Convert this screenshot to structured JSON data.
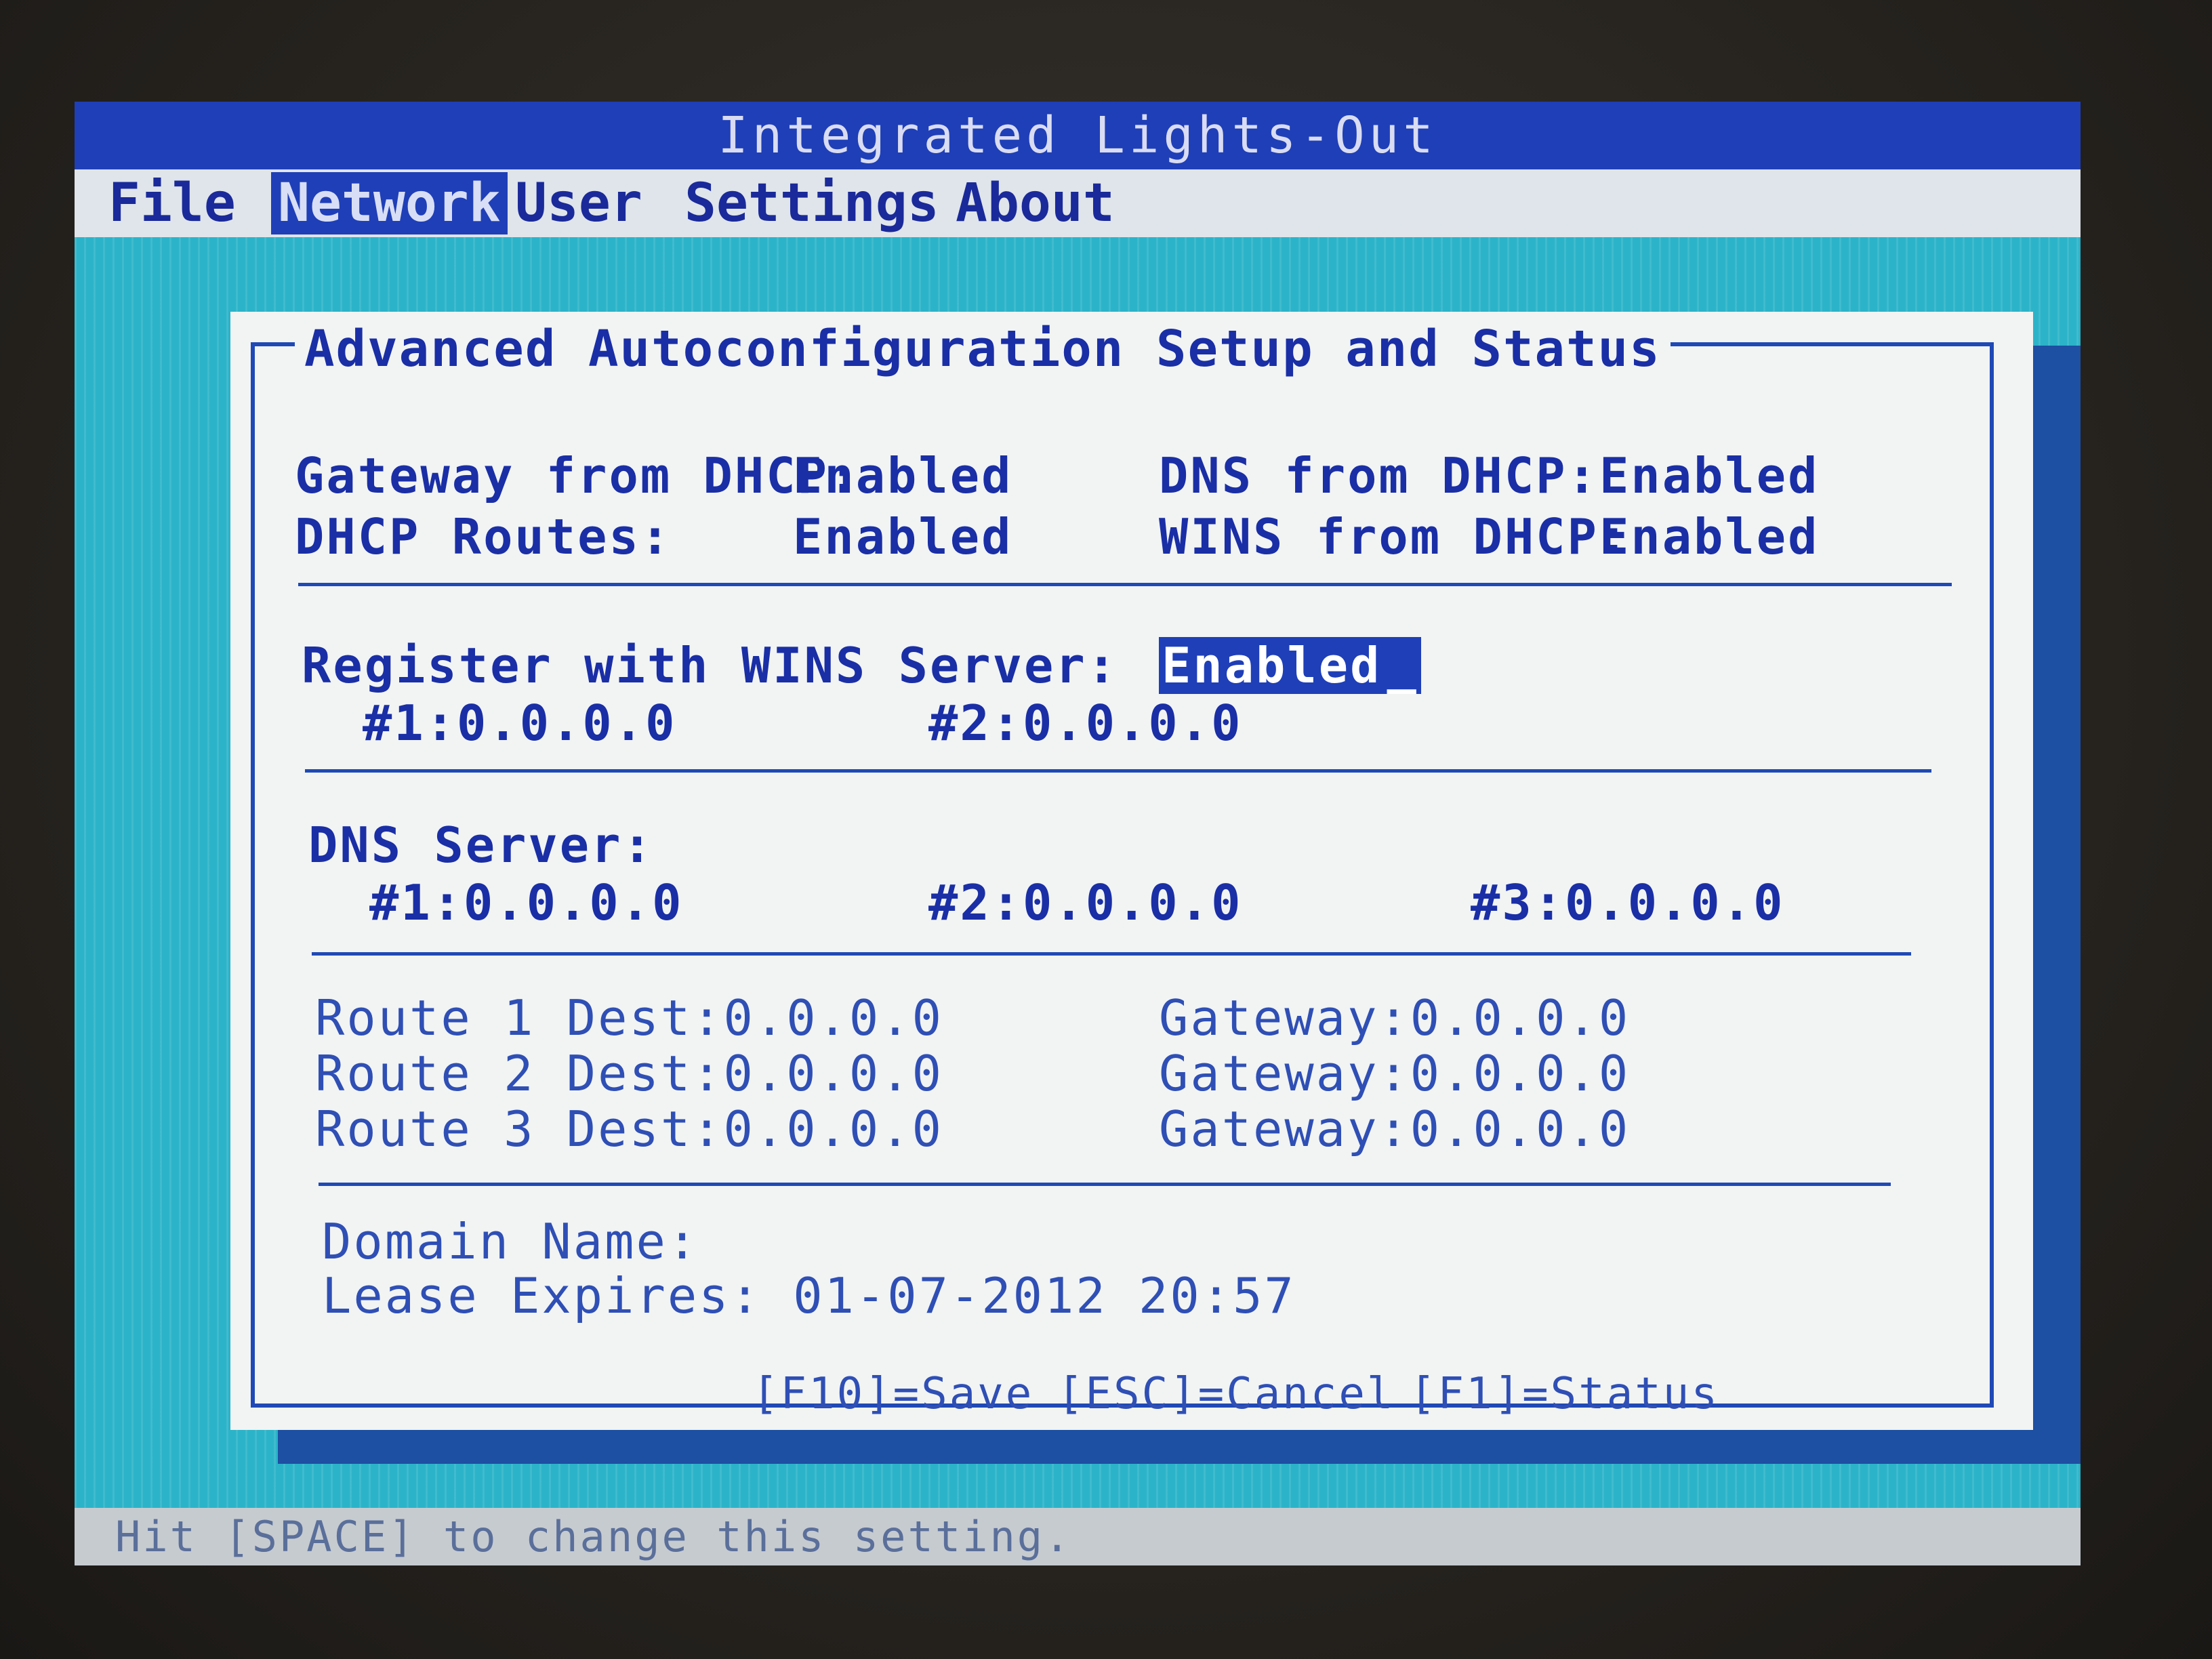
{
  "window": {
    "title": "Integrated Lights-Out"
  },
  "menu": {
    "items": [
      {
        "label": "File"
      },
      {
        "label": "Network"
      },
      {
        "label": "User"
      },
      {
        "label": "Settings"
      },
      {
        "label": "About"
      }
    ],
    "active": "Network"
  },
  "dialog": {
    "title": "Advanced Autoconfiguration Setup and Status",
    "dhcp": {
      "gateway_label": "Gateway from DHCP:",
      "gateway_value": "Enabled",
      "routes_label": "DHCP Routes:",
      "routes_value": "Enabled",
      "dns_label": "DNS from DHCP:",
      "dns_value": "Enabled",
      "wins_label": "WINS from DHCP:",
      "wins_value": "Enabled"
    },
    "wins": {
      "register_label": "Register with WINS Server:",
      "register_value": "Enabled",
      "cursor": "_",
      "server1": "#1:0.0.0.0",
      "server2": "#2:0.0.0.0"
    },
    "dns": {
      "label": "DNS Server:",
      "server1": "#1:0.0.0.0",
      "server2": "#2:0.0.0.0",
      "server3": "#3:0.0.0.0"
    },
    "routes": [
      {
        "dest": "Route 1 Dest:0.0.0.0",
        "gateway": "Gateway:0.0.0.0"
      },
      {
        "dest": "Route 2 Dest:0.0.0.0",
        "gateway": "Gateway:0.0.0.0"
      },
      {
        "dest": "Route 3 Dest:0.0.0.0",
        "gateway": "Gateway:0.0.0.0"
      }
    ],
    "domain_name_label": "Domain Name:",
    "lease_expires": "Lease Expires: 01-07-2012 20:57",
    "keys": {
      "save": "[F10]=Save",
      "cancel": "[ESC]=Cancel",
      "status": "[F1]=Status"
    }
  },
  "statusbar": {
    "text": "Hit [SPACE] to change this setting."
  },
  "colors": {
    "title_bar": "#1f3fb8",
    "background": "#2bb3c9",
    "dialog": "#f1f4f3",
    "text": "#1a2ea6"
  }
}
